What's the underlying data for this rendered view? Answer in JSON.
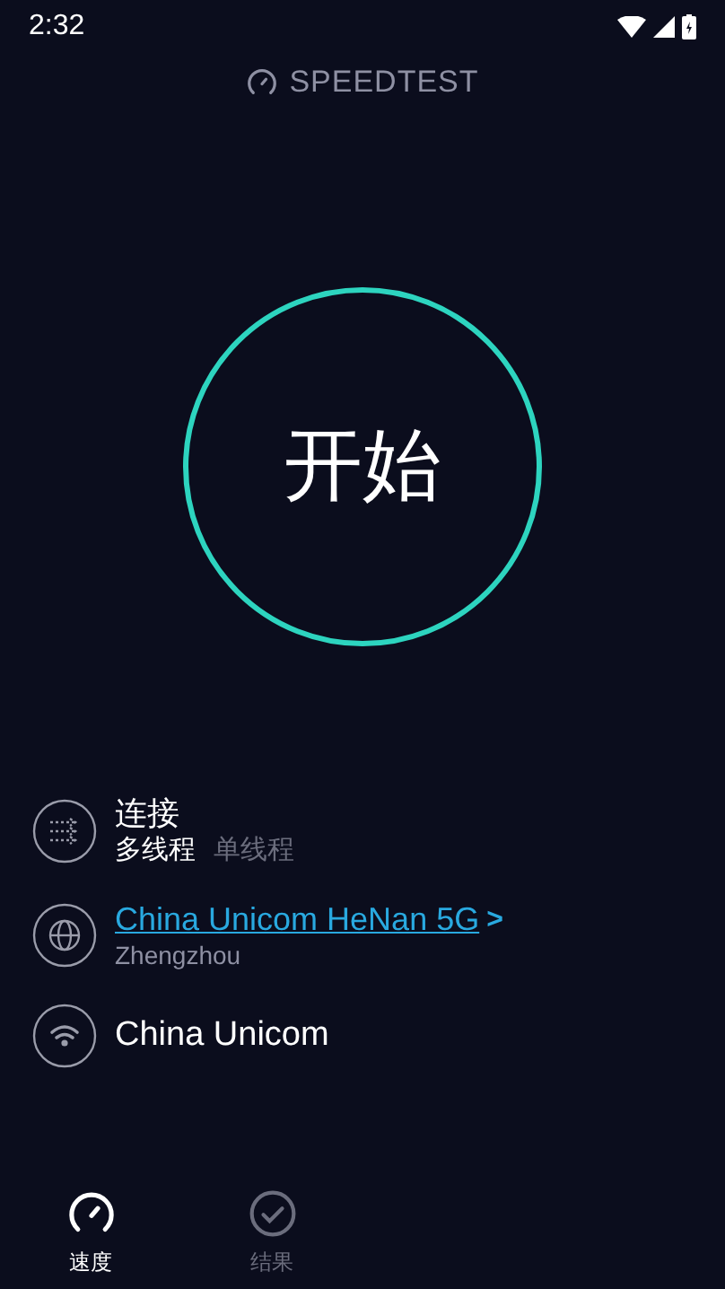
{
  "status_bar": {
    "time": "2:32"
  },
  "header": {
    "title": "SPEEDTEST"
  },
  "start_button": {
    "label": "开始"
  },
  "connections": {
    "label": "连接",
    "options": [
      {
        "label": "多线程",
        "selected": true
      },
      {
        "label": "单线程",
        "selected": false
      }
    ]
  },
  "server": {
    "name": "China Unicom HeNan 5G",
    "chevron": ">",
    "location": "Zhengzhou"
  },
  "provider": {
    "name": "China Unicom"
  },
  "tabs": [
    {
      "label": "速度",
      "selected": true,
      "kind": "speed"
    },
    {
      "label": "结果",
      "selected": false,
      "kind": "results"
    }
  ]
}
